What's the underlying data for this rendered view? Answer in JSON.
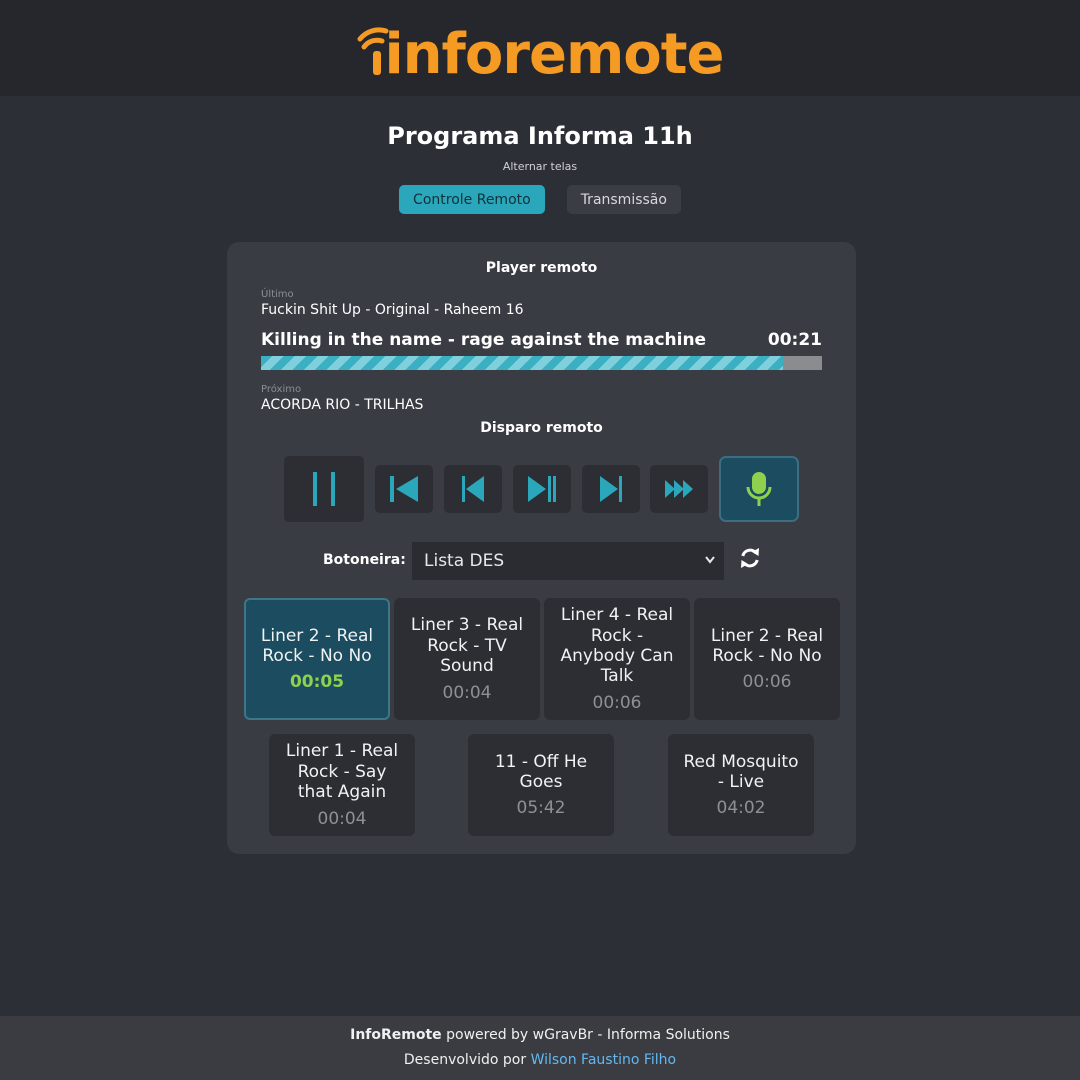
{
  "brand": {
    "logo_text": "inforemote",
    "color": "#f59a23"
  },
  "page": {
    "title": "Programa Informa 11h",
    "switch_label": "Alternar telas",
    "tabs": [
      {
        "label": "Controle Remoto",
        "active": true
      },
      {
        "label": "Transmissão",
        "active": false
      }
    ]
  },
  "player": {
    "title": "Player remoto",
    "last_label": "Último",
    "last_track": "Fuckin Shit Up - Original - Raheem 16",
    "current_track": "Killing in the name - rage against the machine",
    "current_time": "00:21",
    "progress": 0.93,
    "next_label": "Próximo",
    "next_track": "ACORDA RIO - TRILHAS"
  },
  "remote": {
    "title": "Disparo remoto",
    "controls": [
      {
        "icon": "pause-icon"
      },
      {
        "icon": "skip-to-start-icon"
      },
      {
        "icon": "previous-icon"
      },
      {
        "icon": "play-pause-icon"
      },
      {
        "icon": "next-icon"
      },
      {
        "icon": "fast-forward-icon"
      },
      {
        "icon": "microphone-icon"
      }
    ]
  },
  "botoneira": {
    "label": "Botoneira:",
    "selected": "Lista DES",
    "pads": [
      {
        "name": "Liner 2 - Real Rock - No No",
        "time": "00:05",
        "active": true
      },
      {
        "name": "Liner 3 - Real Rock - TV Sound",
        "time": "00:04",
        "active": false
      },
      {
        "name": "Liner 4 - Real Rock - Anybody Can Talk",
        "time": "00:06",
        "active": false
      },
      {
        "name": "Liner 2 - Real Rock - No No",
        "time": "00:06",
        "active": false
      },
      {
        "name": "Liner 1 - Real Rock - Say that Again",
        "time": "00:04",
        "active": false
      },
      {
        "name": "11 - Off He Goes",
        "time": "05:42",
        "active": false
      },
      {
        "name": "Red Mosquito - Live",
        "time": "04:02",
        "active": false
      }
    ]
  },
  "footer": {
    "app_name": "InfoRemote",
    "powered_by": " powered by wGravBr - Informa Solutions",
    "developed_by": "Desenvolvido por ",
    "author": "Wilson Faustino Filho"
  },
  "colors": {
    "accent": "#2aa7ba",
    "active_pad": "#1b4c5f",
    "pad_time_active": "#8fd14f",
    "link": "#62b8f0"
  }
}
